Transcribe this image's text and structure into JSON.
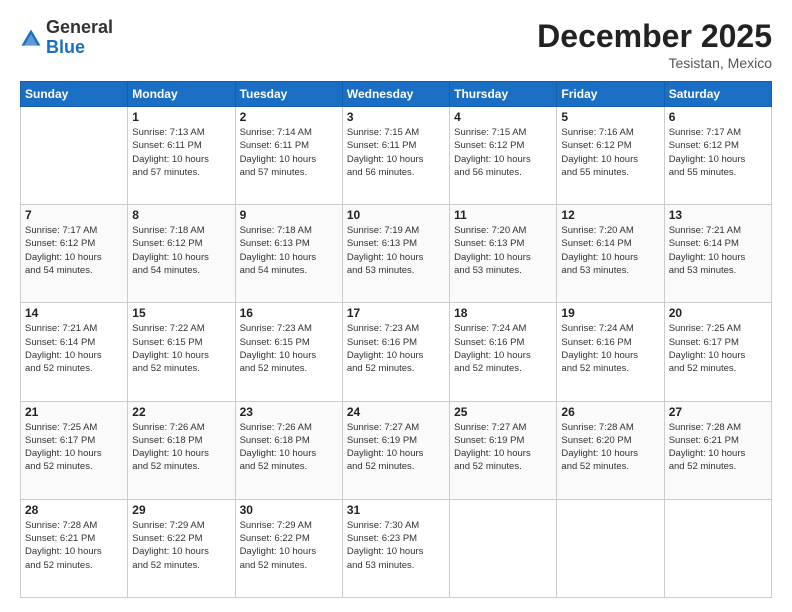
{
  "header": {
    "logo_general": "General",
    "logo_blue": "Blue",
    "month": "December 2025",
    "location": "Tesistan, Mexico"
  },
  "weekdays": [
    "Sunday",
    "Monday",
    "Tuesday",
    "Wednesday",
    "Thursday",
    "Friday",
    "Saturday"
  ],
  "weeks": [
    [
      {
        "day": "",
        "text": ""
      },
      {
        "day": "1",
        "text": "Sunrise: 7:13 AM\nSunset: 6:11 PM\nDaylight: 10 hours\nand 57 minutes."
      },
      {
        "day": "2",
        "text": "Sunrise: 7:14 AM\nSunset: 6:11 PM\nDaylight: 10 hours\nand 57 minutes."
      },
      {
        "day": "3",
        "text": "Sunrise: 7:15 AM\nSunset: 6:11 PM\nDaylight: 10 hours\nand 56 minutes."
      },
      {
        "day": "4",
        "text": "Sunrise: 7:15 AM\nSunset: 6:12 PM\nDaylight: 10 hours\nand 56 minutes."
      },
      {
        "day": "5",
        "text": "Sunrise: 7:16 AM\nSunset: 6:12 PM\nDaylight: 10 hours\nand 55 minutes."
      },
      {
        "day": "6",
        "text": "Sunrise: 7:17 AM\nSunset: 6:12 PM\nDaylight: 10 hours\nand 55 minutes."
      }
    ],
    [
      {
        "day": "7",
        "text": "Sunrise: 7:17 AM\nSunset: 6:12 PM\nDaylight: 10 hours\nand 54 minutes."
      },
      {
        "day": "8",
        "text": "Sunrise: 7:18 AM\nSunset: 6:12 PM\nDaylight: 10 hours\nand 54 minutes."
      },
      {
        "day": "9",
        "text": "Sunrise: 7:18 AM\nSunset: 6:13 PM\nDaylight: 10 hours\nand 54 minutes."
      },
      {
        "day": "10",
        "text": "Sunrise: 7:19 AM\nSunset: 6:13 PM\nDaylight: 10 hours\nand 53 minutes."
      },
      {
        "day": "11",
        "text": "Sunrise: 7:20 AM\nSunset: 6:13 PM\nDaylight: 10 hours\nand 53 minutes."
      },
      {
        "day": "12",
        "text": "Sunrise: 7:20 AM\nSunset: 6:14 PM\nDaylight: 10 hours\nand 53 minutes."
      },
      {
        "day": "13",
        "text": "Sunrise: 7:21 AM\nSunset: 6:14 PM\nDaylight: 10 hours\nand 53 minutes."
      }
    ],
    [
      {
        "day": "14",
        "text": "Sunrise: 7:21 AM\nSunset: 6:14 PM\nDaylight: 10 hours\nand 52 minutes."
      },
      {
        "day": "15",
        "text": "Sunrise: 7:22 AM\nSunset: 6:15 PM\nDaylight: 10 hours\nand 52 minutes."
      },
      {
        "day": "16",
        "text": "Sunrise: 7:23 AM\nSunset: 6:15 PM\nDaylight: 10 hours\nand 52 minutes."
      },
      {
        "day": "17",
        "text": "Sunrise: 7:23 AM\nSunset: 6:16 PM\nDaylight: 10 hours\nand 52 minutes."
      },
      {
        "day": "18",
        "text": "Sunrise: 7:24 AM\nSunset: 6:16 PM\nDaylight: 10 hours\nand 52 minutes."
      },
      {
        "day": "19",
        "text": "Sunrise: 7:24 AM\nSunset: 6:16 PM\nDaylight: 10 hours\nand 52 minutes."
      },
      {
        "day": "20",
        "text": "Sunrise: 7:25 AM\nSunset: 6:17 PM\nDaylight: 10 hours\nand 52 minutes."
      }
    ],
    [
      {
        "day": "21",
        "text": "Sunrise: 7:25 AM\nSunset: 6:17 PM\nDaylight: 10 hours\nand 52 minutes."
      },
      {
        "day": "22",
        "text": "Sunrise: 7:26 AM\nSunset: 6:18 PM\nDaylight: 10 hours\nand 52 minutes."
      },
      {
        "day": "23",
        "text": "Sunrise: 7:26 AM\nSunset: 6:18 PM\nDaylight: 10 hours\nand 52 minutes."
      },
      {
        "day": "24",
        "text": "Sunrise: 7:27 AM\nSunset: 6:19 PM\nDaylight: 10 hours\nand 52 minutes."
      },
      {
        "day": "25",
        "text": "Sunrise: 7:27 AM\nSunset: 6:19 PM\nDaylight: 10 hours\nand 52 minutes."
      },
      {
        "day": "26",
        "text": "Sunrise: 7:28 AM\nSunset: 6:20 PM\nDaylight: 10 hours\nand 52 minutes."
      },
      {
        "day": "27",
        "text": "Sunrise: 7:28 AM\nSunset: 6:21 PM\nDaylight: 10 hours\nand 52 minutes."
      }
    ],
    [
      {
        "day": "28",
        "text": "Sunrise: 7:28 AM\nSunset: 6:21 PM\nDaylight: 10 hours\nand 52 minutes."
      },
      {
        "day": "29",
        "text": "Sunrise: 7:29 AM\nSunset: 6:22 PM\nDaylight: 10 hours\nand 52 minutes."
      },
      {
        "day": "30",
        "text": "Sunrise: 7:29 AM\nSunset: 6:22 PM\nDaylight: 10 hours\nand 52 minutes."
      },
      {
        "day": "31",
        "text": "Sunrise: 7:30 AM\nSunset: 6:23 PM\nDaylight: 10 hours\nand 53 minutes."
      },
      {
        "day": "",
        "text": ""
      },
      {
        "day": "",
        "text": ""
      },
      {
        "day": "",
        "text": ""
      }
    ]
  ]
}
